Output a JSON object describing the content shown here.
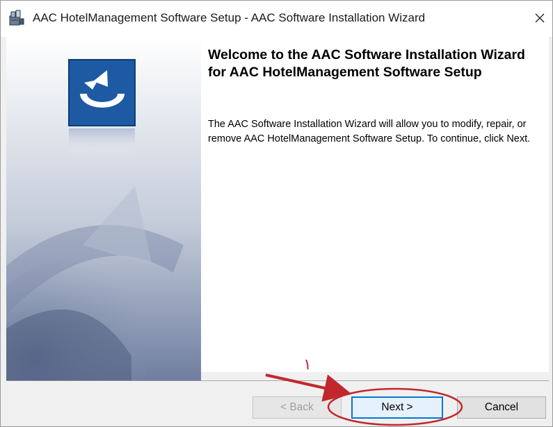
{
  "window": {
    "title": "AAC HotelManagement Software Setup - AAC Software Installation Wizard",
    "close_glyph": "✕"
  },
  "main": {
    "heading": "Welcome to the AAC Software Installation Wizard for AAC HotelManagement Software Setup",
    "body": "The AAC Software Installation Wizard will allow you to modify, repair, or remove AAC HotelManagement Software Setup. To continue, click Next."
  },
  "buttons": {
    "back": "< Back",
    "next": "Next >",
    "cancel": "Cancel"
  },
  "annotation": {
    "marker": "١",
    "color": "#c0282d"
  },
  "icons": {
    "app": "installer-package-icon",
    "logo": "aac-setup-logo-icon",
    "close": "close-icon"
  }
}
